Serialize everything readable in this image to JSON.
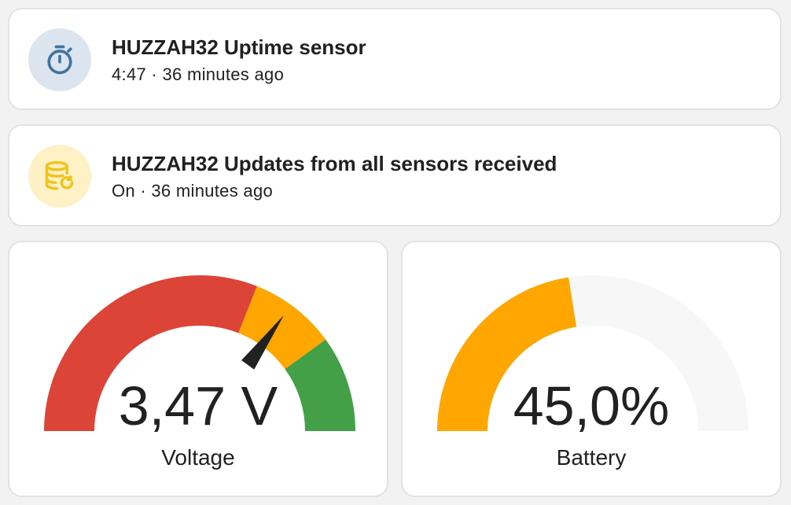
{
  "colors": {
    "uptime_icon_bg": "#dce5ef",
    "uptime_icon_fg": "#44739e",
    "updates_icon_bg": "#fdf1c5",
    "updates_icon_fg": "#f0c419",
    "gauge_red": "#db4437",
    "gauge_orange": "#ffa600",
    "gauge_green": "#43a047",
    "gauge_track": "#f7f7f7",
    "needle": "#212121"
  },
  "tiles": [
    {
      "icon": "timer-icon",
      "title": "HUZZAH32 Uptime sensor",
      "state": "4:47 · 36 minutes ago"
    },
    {
      "icon": "database-sync-icon",
      "title": "HUZZAH32 Updates from all sensors received",
      "state": "On · 36 minutes ago"
    }
  ],
  "gauges": {
    "voltage": {
      "value_text": "3,47 V",
      "label": "Voltage",
      "value_fraction": 0.7,
      "segments": [
        {
          "from": 0.0,
          "to": 0.62,
          "color": "#db4437"
        },
        {
          "from": 0.62,
          "to": 0.8,
          "color": "#ffa600"
        },
        {
          "from": 0.8,
          "to": 1.0,
          "color": "#43a047"
        }
      ]
    },
    "battery": {
      "value_text": "45,0%",
      "label": "Battery",
      "value_fraction": 0.45,
      "color": "#ffa600"
    }
  }
}
